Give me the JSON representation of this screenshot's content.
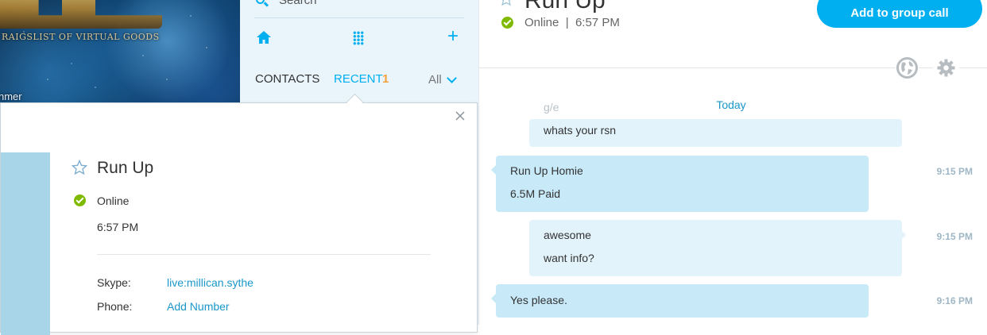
{
  "banner": {
    "tagline": "RAIGSLIST OF VIRTUAL GOODS",
    "corner_text": "nmer"
  },
  "sidebar": {
    "search_label": "Search",
    "tabs": [
      {
        "label": "CONTACTS",
        "active": false
      },
      {
        "label": "RECENT",
        "active": true,
        "count": "1"
      }
    ],
    "filter_label": "All"
  },
  "profile_card": {
    "name": "Run Up",
    "status": "Online",
    "local_time": "6:57 PM",
    "fields": [
      {
        "label": "Skype:",
        "value": "live:millican.sythe"
      },
      {
        "label": "Phone:",
        "value": "Add Number"
      }
    ]
  },
  "conversation": {
    "title": "Run Up",
    "status": "Online",
    "separator": "|",
    "local_time": "6:57 PM",
    "group_call_label": "Add to group call",
    "date_separator": "Today",
    "ghost_lines": [
      "",
      "g/e"
    ],
    "messages": [
      {
        "direction": "out",
        "lines": [
          "whats your rsn"
        ],
        "time": ""
      },
      {
        "direction": "in",
        "lines": [
          "Run Up Homie",
          "6.5M Paid"
        ],
        "time": "9:15 PM"
      },
      {
        "direction": "out",
        "lines": [
          "awesome",
          "want info?"
        ],
        "time": "9:15 PM"
      },
      {
        "direction": "in",
        "lines": [
          "Yes please."
        ],
        "time": "9:16 PM"
      }
    ]
  },
  "colors": {
    "accent": "#00aff0",
    "online": "#7fba00",
    "recent_badge": "#f4a13b",
    "incoming_bubble": "#c8e9f8",
    "outgoing_bubble": "#e2f3fb"
  }
}
